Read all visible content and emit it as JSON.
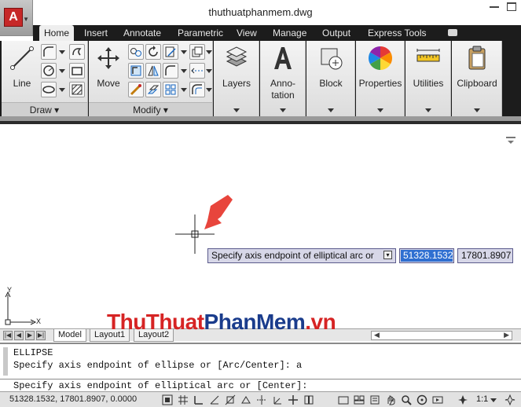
{
  "window": {
    "title": "thuthuatphanmem.dwg"
  },
  "ribbon_tabs": [
    "Home",
    "Insert",
    "Annotate",
    "Parametric",
    "View",
    "Manage",
    "Output",
    "Express Tools"
  ],
  "ribbon": {
    "draw": {
      "title": "Draw",
      "line_label": "Line"
    },
    "modify": {
      "title": "Modify",
      "move_label": "Move"
    },
    "layers_label": "Layers",
    "annotation_label_1": "Anno-",
    "annotation_label_2": "tation",
    "block_label": "Block",
    "properties_label": "Properties",
    "utilities_label": "Utilities",
    "clipboard_label": "Clipboard"
  },
  "canvas": {
    "prompt": "Specify axis endpoint of elliptical arc or",
    "x_value": "51328.1532",
    "y_value": "17801.8907",
    "ucs_y": "Y",
    "ucs_x": "X"
  },
  "layout_tabs": [
    "Model",
    "Layout1",
    "Layout2"
  ],
  "command": {
    "history_1": "ELLIPSE",
    "history_2": "Specify axis endpoint of ellipse or [Arc/Center]: a",
    "current": "Specify axis endpoint of elliptical arc or [Center]:"
  },
  "status": {
    "coordinates": "51328.1532, 17801.8907, 0.0000",
    "scale": "1:1"
  },
  "watermark": {
    "part1": "ThuThuat",
    "part2": "PhanMem",
    "part3": ".vn"
  },
  "colors": {
    "ribbon_dark": "#1c1c1c",
    "selection_blue": "#2f6fd1",
    "annotation_arrow": "#e8453c"
  }
}
